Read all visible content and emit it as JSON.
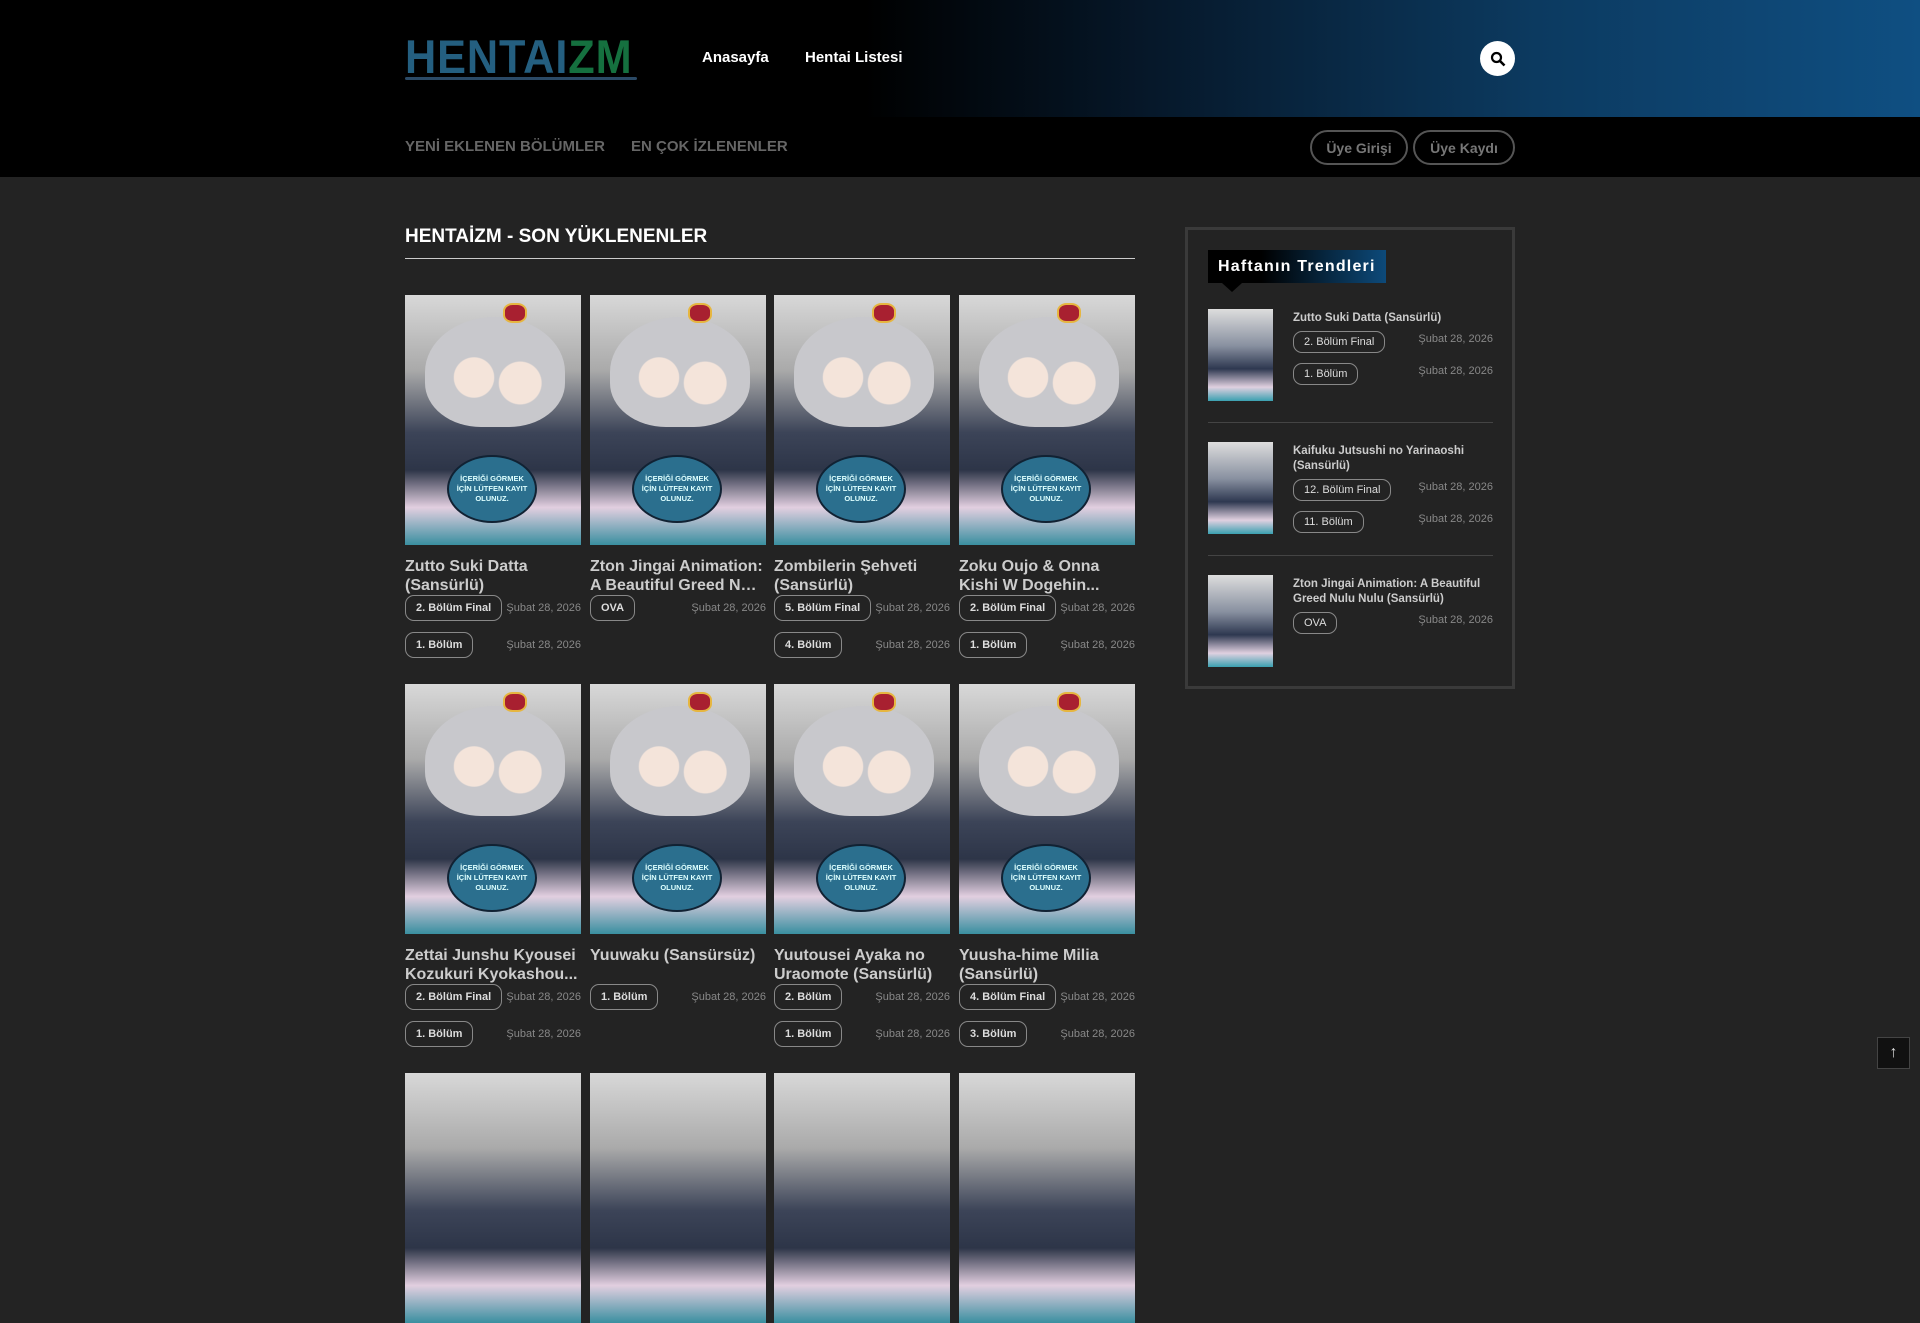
{
  "header": {
    "logo_a": "HENTAI",
    "logo_b": "ZM",
    "nav": [
      "Anasayfa",
      "Hentai Listesi"
    ]
  },
  "subnav": {
    "items": [
      "YENİ EKLENEN BÖLÜMLER",
      "EN ÇOK İZLENENLER"
    ],
    "login": "Üye Girişi",
    "register": "Üye Kaydı"
  },
  "main": {
    "title": "HENTAİZM - SON YÜKLENENLER",
    "thumb_text": "İÇERİĞİ GÖRMEK İÇİN LÜTFEN KAYIT OLUNUZ.",
    "cards": [
      {
        "title": "Zutto Suki Datta (Sansürlü)",
        "episodes": [
          {
            "label": "2. Bölüm Final",
            "date": "Şubat 28, 2026"
          },
          {
            "label": "1. Bölüm",
            "date": "Şubat 28, 2026"
          }
        ]
      },
      {
        "title": "Zton Jingai Animation: A Beautiful Greed Nulu Nulu (Sansürlü)",
        "episodes": [
          {
            "label": "OVA",
            "date": "Şubat 28, 2026"
          }
        ]
      },
      {
        "title": "Zombilerin Şehveti (Sansürlü)",
        "episodes": [
          {
            "label": "5. Bölüm Final",
            "date": "Şubat 28, 2026"
          },
          {
            "label": "4. Bölüm",
            "date": "Şubat 28, 2026"
          }
        ]
      },
      {
        "title": "Zoku Oujo & Onna Kishi W Dogehin...",
        "episodes": [
          {
            "label": "2. Bölüm Final",
            "date": "Şubat 28, 2026"
          },
          {
            "label": "1. Bölüm",
            "date": "Şubat 28, 2026"
          }
        ]
      },
      {
        "title": "Zettai Junshu Kyousei Kozukuri Kyokashou...",
        "episodes": [
          {
            "label": "2. Bölüm Final",
            "date": "Şubat 28, 2026"
          },
          {
            "label": "1. Bölüm",
            "date": "Şubat 28, 2026"
          }
        ]
      },
      {
        "title": "Yuuwaku (Sansürsüz)",
        "episodes": [
          {
            "label": "1. Bölüm",
            "date": "Şubat 28, 2026"
          }
        ]
      },
      {
        "title": "Yuutousei Ayaka no Uraomote (Sansürlü)",
        "episodes": [
          {
            "label": "2. Bölüm",
            "date": "Şubat 28, 2026"
          },
          {
            "label": "1. Bölüm",
            "date": "Şubat 28, 2026"
          }
        ]
      },
      {
        "title": "Yuusha-hime Milia (Sansürlü)",
        "episodes": [
          {
            "label": "4. Bölüm Final",
            "date": "Şubat 28, 2026"
          },
          {
            "label": "3. Bölüm",
            "date": "Şubat 28, 2026"
          }
        ]
      }
    ]
  },
  "sidebar": {
    "title": "Haftanın Trendleri",
    "items": [
      {
        "title": "Zutto Suki Datta (Sansürlü)",
        "episodes": [
          {
            "label": "2. Bölüm Final",
            "date": "Şubat 28, 2026"
          },
          {
            "label": "1. Bölüm",
            "date": "Şubat 28, 2026"
          }
        ]
      },
      {
        "title": "Kaifuku Jutsushi no Yarinaoshi (Sansürlü)",
        "episodes": [
          {
            "label": "12. Bölüm Final",
            "date": "Şubat 28, 2026"
          },
          {
            "label": "11. Bölüm",
            "date": "Şubat 28, 2026"
          }
        ]
      },
      {
        "title": "Zton Jingai Animation: A Beautiful Greed Nulu Nulu (Sansürlü)",
        "episodes": [
          {
            "label": "OVA",
            "date": "Şubat 28, 2026"
          }
        ]
      }
    ]
  },
  "back_to_top": "↑"
}
